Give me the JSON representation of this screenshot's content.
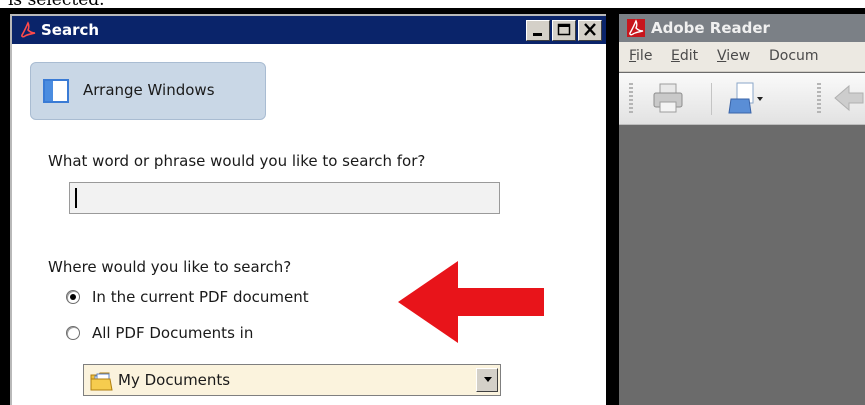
{
  "caption_fragment": "is selected.",
  "search_window": {
    "title": "Search",
    "arrange_button_label": "Arrange Windows",
    "question_label": "What word or phrase would you like to search for?",
    "search_input_value": "",
    "where_label": "Where would you like to search?",
    "radio_options": [
      {
        "label": "In the current PDF document",
        "checked": true
      },
      {
        "label": "All PDF Documents in",
        "checked": false
      }
    ],
    "location_dropdown_value": "My Documents",
    "window_buttons": [
      "minimize-icon",
      "maximize-icon",
      "close-icon"
    ]
  },
  "reader_window": {
    "title": "Adobe Reader",
    "menu": [
      {
        "label": "File",
        "underline": "F"
      },
      {
        "label": "Edit",
        "underline": "E"
      },
      {
        "label": "View",
        "underline": "V"
      },
      {
        "label": "Docum",
        "underline": ""
      }
    ],
    "toolbar_icons": [
      "print-icon",
      "create-pdf-icon",
      "back-icon"
    ]
  },
  "annotation": {
    "arrow_color": "#e8141a",
    "arrow_direction": "left"
  },
  "colors": {
    "titlebar_active": "#0a246a",
    "titlebar_inactive": "#7b8086",
    "arrange_button_bg": "#c9d7e6",
    "dropdown_bg": "#fbf3dd",
    "acrobat_red": "#d3262b"
  }
}
